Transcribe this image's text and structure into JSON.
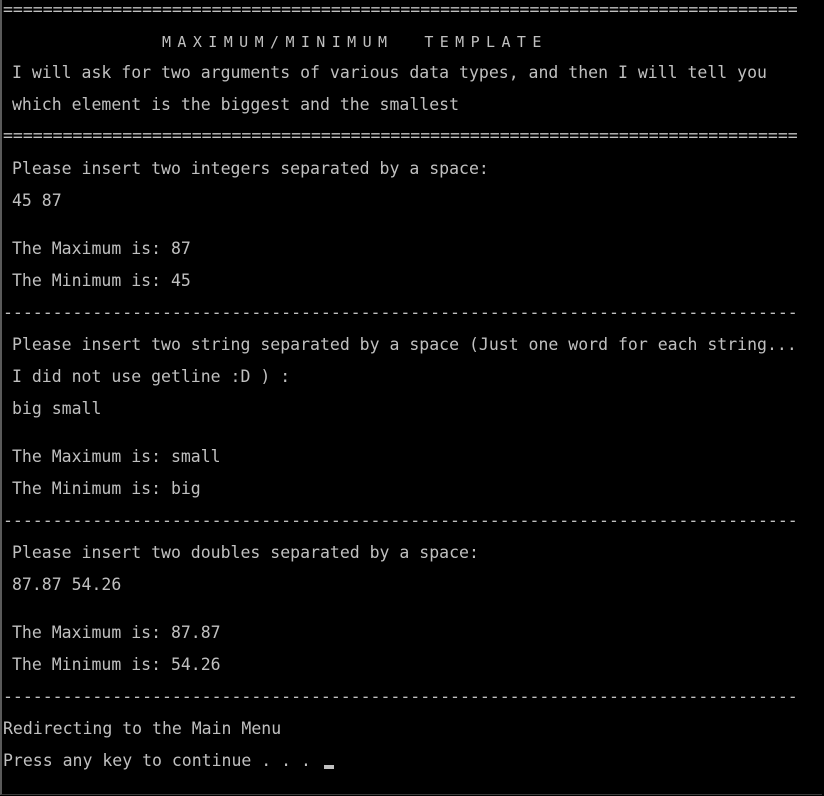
{
  "window": {
    "rule_double": "================================================================================",
    "rule_single": "--------------------------------------------------------------------------------"
  },
  "header": {
    "title": "MAXIMUM/MINIMUM  TEMPLATE",
    "intro_line1": "I will ask for two arguments of various data types, and then I will tell you",
    "intro_line2": "which element is the biggest and the smallest"
  },
  "int_section": {
    "prompt": "Please insert two integers separated by a space:",
    "input": "45 87",
    "max": "The Maximum is: 87",
    "min": "The Minimum is: 45"
  },
  "string_section": {
    "prompt": "Please insert two string separated by a space (Just one word for each string...",
    "prompt2": "I did not use getline :D ) :",
    "input": "big small",
    "max": "The Maximum is: small",
    "min": "The Minimum is: big"
  },
  "double_section": {
    "prompt": "Please insert two doubles separated by a space:",
    "input": "87.87 54.26",
    "max": "The Maximum is: 87.87",
    "min": "The Minimum is: 54.26"
  },
  "footer": {
    "redirect": "Redirecting to the Main Menu",
    "continue": "Press any key to continue . . . "
  }
}
